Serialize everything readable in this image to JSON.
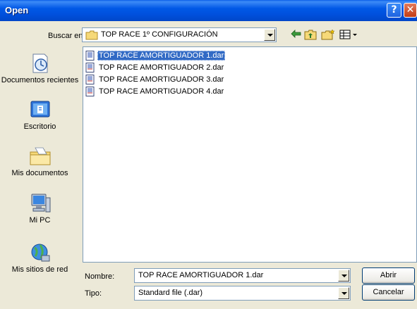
{
  "window": {
    "title": "Open",
    "help_glyph": "?",
    "close_glyph": "✕"
  },
  "lookin": {
    "label": "Buscar en:",
    "value": "TOP RACE 1º CONFIGURACIÓN"
  },
  "toolbar": {
    "icons": [
      "back-icon",
      "up-folder-icon",
      "new-folder-icon",
      "views-menu-icon"
    ]
  },
  "places": [
    {
      "label": "Documentos recientes",
      "icon": "recent-documents-icon"
    },
    {
      "label": "Escritorio",
      "icon": "desktop-icon"
    },
    {
      "label": "Mis documentos",
      "icon": "my-documents-icon"
    },
    {
      "label": "Mi PC",
      "icon": "my-computer-icon"
    },
    {
      "label": "Mis sitios de red",
      "icon": "network-places-icon"
    }
  ],
  "files": [
    {
      "name": "TOP RACE AMORTIGUADOR 1.dar",
      "selected": true
    },
    {
      "name": "TOP RACE AMORTIGUADOR 2.dar",
      "selected": false
    },
    {
      "name": "TOP RACE AMORTIGUADOR 3.dar",
      "selected": false
    },
    {
      "name": "TOP RACE AMORTIGUADOR 4.dar",
      "selected": false
    }
  ],
  "filename": {
    "label": "Nombre:",
    "value": "TOP RACE AMORTIGUADOR 1.dar"
  },
  "filetype": {
    "label": "Tipo:",
    "value": "Standard file (.dar)"
  },
  "buttons": {
    "open": "Abrir",
    "cancel": "Cancelar"
  },
  "colors": {
    "titlebar": "#0058E6",
    "selection": "#316AC5",
    "dialog_bg": "#ECE9D8"
  }
}
